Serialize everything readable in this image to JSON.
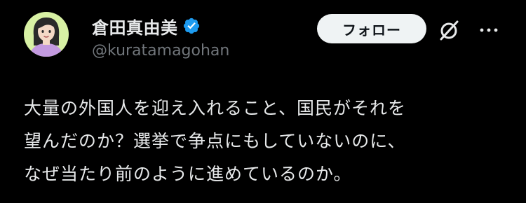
{
  "author": {
    "display_name": "倉田真由美",
    "handle": "@kuratamagohan",
    "verified": true
  },
  "actions": {
    "follow_label": "フォロー",
    "grok_icon": "grok-slash-icon",
    "more_icon": "more-horizontal-icon"
  },
  "post": {
    "lines": [
      "大量の外国人を迎え入れること、国民がそれを",
      "望んだのか？選挙で争点にもしていないのに、",
      "なぜ当たり前のように進めているのか。"
    ]
  },
  "colors": {
    "background": "#000000",
    "text": "#e7e9ea",
    "secondary_text": "#71767b",
    "verified_badge": "#1d9bf0",
    "follow_button_bg": "#eff3f4",
    "avatar_bg": "#d8f1a4",
    "avatar_shirt": "#c39ae0"
  }
}
